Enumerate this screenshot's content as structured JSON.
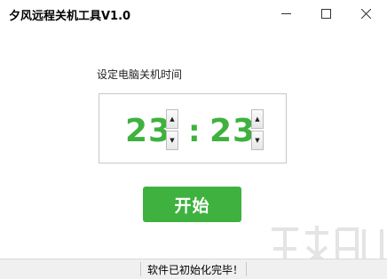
{
  "window": {
    "title": "夕风远程关机工具V1.0"
  },
  "prompt": "设定电脑关机时间",
  "time": {
    "hour": "23",
    "separator": ":",
    "minute": "23"
  },
  "spinner": {
    "up": "▲",
    "down": "▼"
  },
  "start_button": "开始",
  "status": "软件已初始化完毕！",
  "colors": {
    "accent": "#3fb13f",
    "statusbar": "#f0f0f0"
  }
}
